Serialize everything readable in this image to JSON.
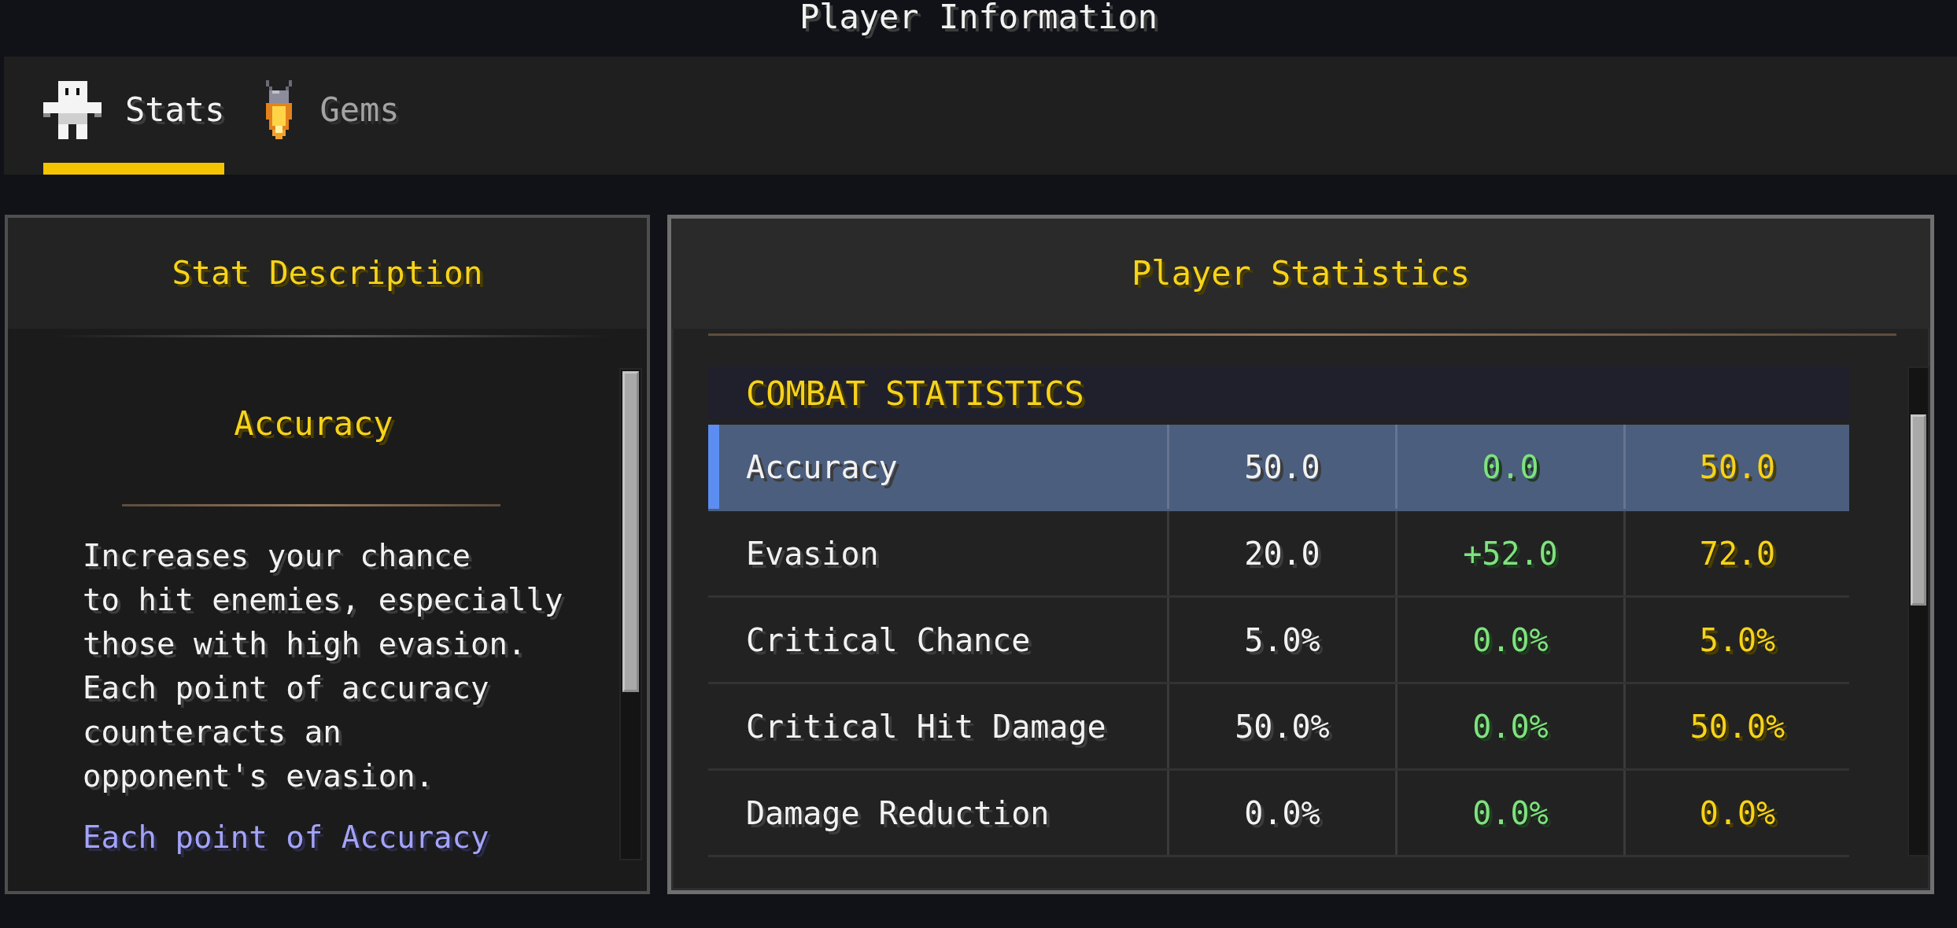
{
  "window": {
    "title": "Player Information"
  },
  "tabs": [
    {
      "label": "Stats",
      "kind": "player",
      "selected": true
    },
    {
      "label": "Gems",
      "kind": "gem",
      "selected": false
    }
  ],
  "description_panel": {
    "title": "Stat Description",
    "stat_name": "Accuracy",
    "text": "Increases your chance\nto hit enemies, especially\nthose with high evasion.\nEach point of accuracy\ncounteracts an\nopponent's evasion.",
    "note": "Each point of Accuracy"
  },
  "statistics_panel": {
    "title": "Player Statistics",
    "section": "COMBAT STATISTICS",
    "rows": [
      {
        "cells": [
          "Accuracy",
          "50.0",
          "0.0",
          "50.0"
        ],
        "selected": true
      },
      {
        "cells": [
          "Evasion",
          "20.0",
          "+52.0",
          "72.0"
        ],
        "selected": false
      },
      {
        "cells": [
          "Critical Chance",
          "5.0%",
          "0.0%",
          "5.0%"
        ],
        "selected": false
      },
      {
        "cells": [
          "Critical Hit Damage",
          "50.0%",
          "0.0%",
          "50.0%"
        ],
        "selected": false
      },
      {
        "cells": [
          "Damage Reduction",
          "0.0%",
          "0.0%",
          "0.0%"
        ],
        "selected": false
      }
    ]
  }
}
